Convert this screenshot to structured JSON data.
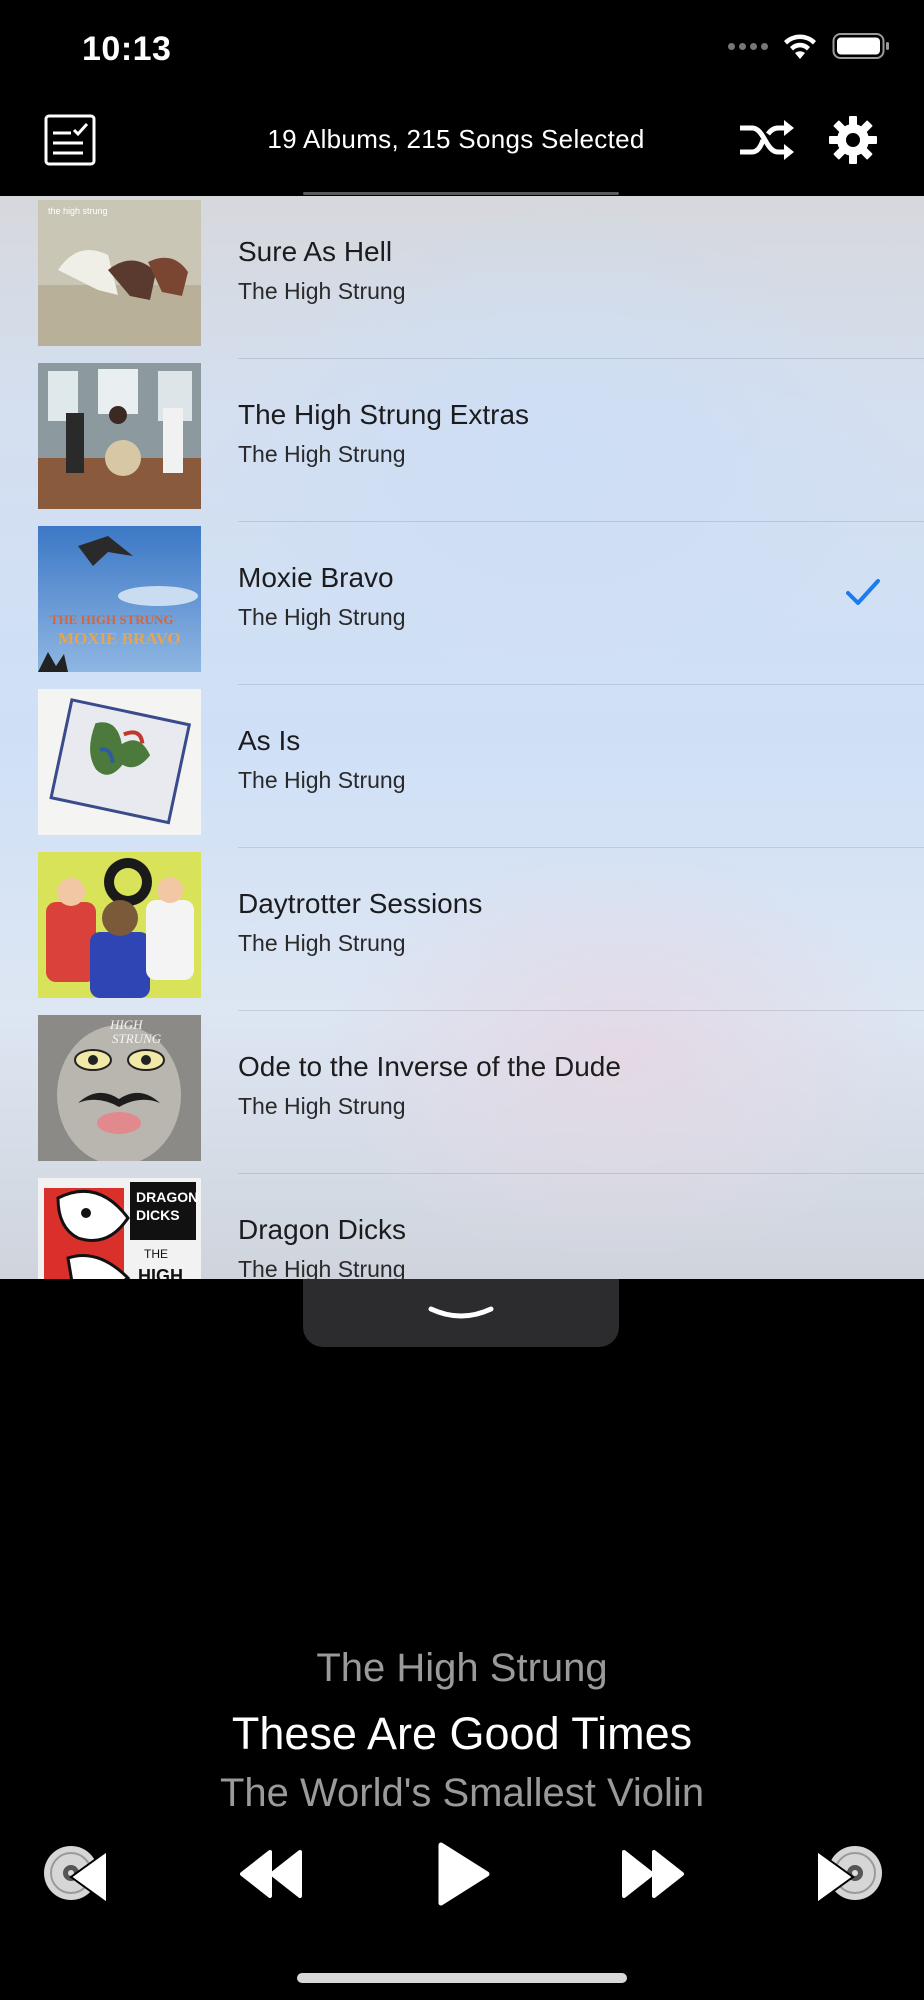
{
  "status_bar": {
    "time": "10:13",
    "icons": [
      "cellular-dots-icon",
      "wifi-icon",
      "battery-icon"
    ]
  },
  "toolbar": {
    "title": "19 Albums, 215 Songs Selected",
    "left_icon": "checklist-icon",
    "right_icons": [
      "shuffle-icon",
      "gear-icon"
    ]
  },
  "albums": [
    {
      "title": "Sure As Hell",
      "artist": "The High Strung",
      "selected": false,
      "cover_label": "the high strung"
    },
    {
      "title": "The High Strung Extras",
      "artist": "The High Strung",
      "selected": false,
      "cover_label": ""
    },
    {
      "title": "Moxie Bravo",
      "artist": "The High Strung",
      "selected": true,
      "cover_label": "THE HIGH STRUNG MOXIE BRAVO"
    },
    {
      "title": "As Is",
      "artist": "The High Strung",
      "selected": false,
      "cover_label": ""
    },
    {
      "title": "Daytrotter Sessions",
      "artist": "The High Strung",
      "selected": false,
      "cover_label": ""
    },
    {
      "title": "Ode to the Inverse of the Dude",
      "artist": "The High Strung",
      "selected": false,
      "cover_label": "HIGH STRUNG"
    },
    {
      "title": "Dragon Dicks",
      "artist": "The High Strung",
      "selected": false,
      "cover_label": "DRAGON DICKS THE HIGH"
    }
  ],
  "now_playing": {
    "artist": "The High Strung",
    "song": "These Are Good Times",
    "album": "The World's Smallest Violin"
  },
  "controls": [
    "previous-album-icon",
    "rewind-icon",
    "play-icon",
    "fast-forward-icon",
    "next-album-icon"
  ],
  "colors": {
    "accent": "#1a7cf0",
    "background": "#000000",
    "secondary_text": "#9a9a9a"
  }
}
